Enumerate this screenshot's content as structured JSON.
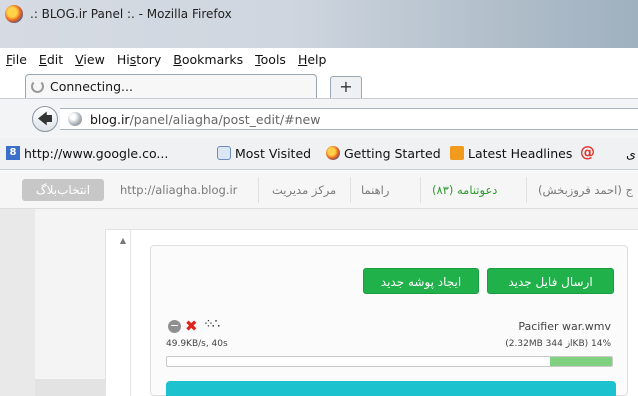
{
  "window": {
    "title": ".: BLOG.ir Panel :. - Mozilla Firefox"
  },
  "menu": [
    {
      "key": "F",
      "rest": "ile"
    },
    {
      "key": "E",
      "rest": "dit"
    },
    {
      "key": "V",
      "rest": "iew"
    },
    {
      "pre": "Hi",
      "key": "s",
      "rest": "tory"
    },
    {
      "key": "B",
      "rest": "ookmarks"
    },
    {
      "key": "T",
      "rest": "ools"
    },
    {
      "key": "H",
      "rest": "elp"
    }
  ],
  "tab": {
    "label": "Connecting...",
    "new_tab": "+"
  },
  "nav": {
    "back": "🡄",
    "url_host": "blog.ir",
    "url_path": "/panel/aliagha/post_edit/#new"
  },
  "bookmarks": {
    "google": "http://www.google.co...",
    "most_visited": "Most Visited",
    "getting_started": "Getting Started",
    "latest_headlines": "Latest Headlines",
    "at": "@",
    "cut_text": "ی"
  },
  "blognav": {
    "select_blog": "انتخاب‌بلاگ",
    "blog_url": "http://aliagha.blog.ir",
    "manage_center": "مرکز مدیریت",
    "guide": "راهنما",
    "invites": "دعوتنامه (۸۳)",
    "user": "ج (احمد فروزبخش)"
  },
  "upload": {
    "btn_file": "ارسال فایل جدید",
    "btn_folder": "ایجاد پوشه جدید",
    "file_name": "Pacifier war.wmv",
    "file_size": "(2.32MB از 344KB) 14%",
    "speed": "49.9KB/s, 40s",
    "progress_fraction": 0.14
  }
}
